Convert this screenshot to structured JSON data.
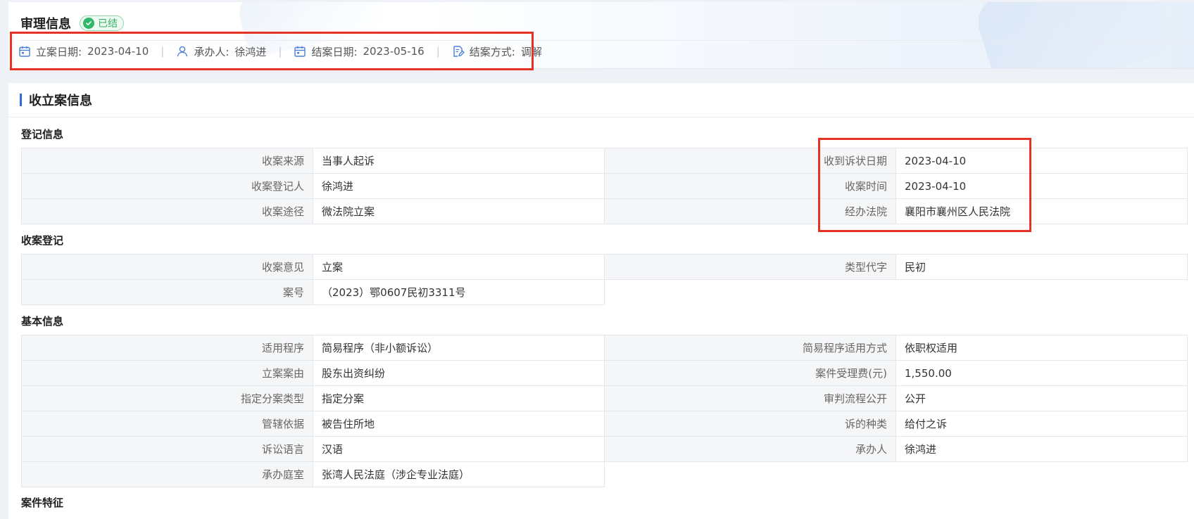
{
  "header": {
    "title": "审理信息",
    "status": "已结",
    "meta": [
      {
        "icon": "calendar-icon",
        "label": "立案日期:",
        "value": "2023-04-10"
      },
      {
        "icon": "user-icon",
        "label": "承办人:",
        "value": "徐鸿进"
      },
      {
        "icon": "calendar-icon",
        "label": "结案日期:",
        "value": "2023-05-16"
      },
      {
        "icon": "document-edit-icon",
        "label": "结案方式:",
        "value": "调解"
      }
    ],
    "separator": "|"
  },
  "section": {
    "title": "收立案信息",
    "groups": [
      {
        "title": "登记信息",
        "rows": [
          [
            {
              "label": "收案来源",
              "value": "当事人起诉"
            },
            {
              "label": "收到诉状日期",
              "value": "2023-04-10"
            }
          ],
          [
            {
              "label": "收案登记人",
              "value": "徐鸿进"
            },
            {
              "label": "收案时间",
              "value": "2023-04-10"
            }
          ],
          [
            {
              "label": "收案途径",
              "value": "微法院立案"
            },
            {
              "label": "经办法院",
              "value": "襄阳市襄州区人民法院"
            }
          ]
        ]
      },
      {
        "title": "收案登记",
        "rows": [
          [
            {
              "label": "收案意见",
              "value": "立案"
            },
            {
              "label": "类型代字",
              "value": "民初"
            }
          ],
          [
            {
              "label": "案号",
              "value": "（2023）鄂0607民初3311号"
            }
          ]
        ]
      },
      {
        "title": "基本信息",
        "rows": [
          [
            {
              "label": "适用程序",
              "value": "简易程序（非小额诉讼）"
            },
            {
              "label": "简易程序适用方式",
              "value": "依职权适用"
            }
          ],
          [
            {
              "label": "立案案由",
              "value": "股东出资纠纷"
            },
            {
              "label": "案件受理费(元)",
              "value": "1,550.00"
            }
          ],
          [
            {
              "label": "指定分案类型",
              "value": "指定分案"
            },
            {
              "label": "审判流程公开",
              "value": "公开"
            }
          ],
          [
            {
              "label": "管辖依据",
              "value": "被告住所地"
            },
            {
              "label": "诉的种类",
              "value": "给付之诉"
            }
          ],
          [
            {
              "label": "诉讼语言",
              "value": "汉语"
            },
            {
              "label": "承办人",
              "value": "徐鸿进"
            }
          ],
          [
            {
              "label": "承办庭室",
              "value": "张湾人民法庭（涉企专业法庭）"
            }
          ]
        ]
      },
      {
        "title": "案件特征",
        "rows": []
      }
    ]
  },
  "colors": {
    "accent": "#2f6fd6",
    "status_green": "#32b768",
    "highlight_red": "#e53223",
    "label_bg": "#f5f6f8",
    "border": "#e3e6eb"
  }
}
